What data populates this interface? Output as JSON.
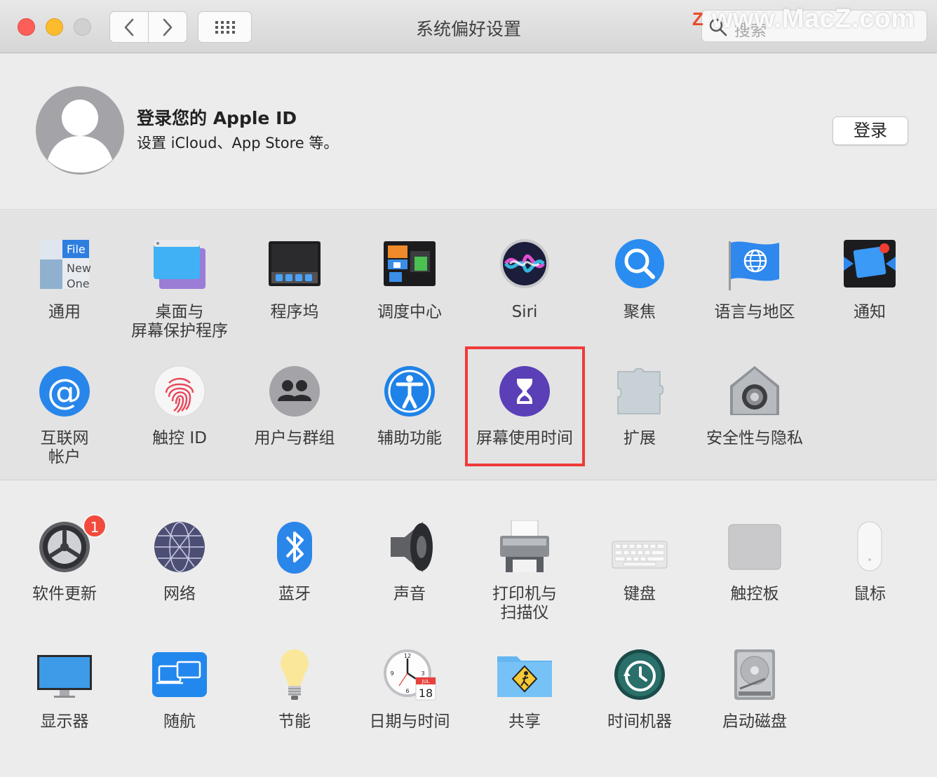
{
  "window": {
    "title": "系统偏好设置",
    "search_placeholder": "搜索"
  },
  "watermark": {
    "z": "Z",
    "text": "www.MacZ.com"
  },
  "account": {
    "title": "登录您的 Apple ID",
    "subtitle": "设置 iCloud、App Store 等。",
    "login_button": "登录"
  },
  "row1": [
    {
      "label": "通用",
      "icon": "general-icon"
    },
    {
      "label": "桌面与\n屏幕保护程序",
      "icon": "desktop-screensaver-icon"
    },
    {
      "label": "程序坞",
      "icon": "dock-icon"
    },
    {
      "label": "调度中心",
      "icon": "mission-control-icon"
    },
    {
      "label": "Siri",
      "icon": "siri-icon"
    },
    {
      "label": "聚焦",
      "icon": "spotlight-icon"
    },
    {
      "label": "语言与地区",
      "icon": "language-region-icon"
    },
    {
      "label": "通知",
      "icon": "notifications-icon"
    }
  ],
  "row2": [
    {
      "label": "互联网\n帐户",
      "icon": "internet-accounts-icon"
    },
    {
      "label": "触控 ID",
      "icon": "touch-id-icon"
    },
    {
      "label": "用户与群组",
      "icon": "users-groups-icon"
    },
    {
      "label": "辅助功能",
      "icon": "accessibility-icon"
    },
    {
      "label": "屏幕使用时间",
      "icon": "screen-time-icon"
    },
    {
      "label": "扩展",
      "icon": "extensions-icon"
    },
    {
      "label": "安全性与隐私",
      "icon": "security-privacy-icon"
    }
  ],
  "row3": [
    {
      "label": "软件更新",
      "icon": "software-update-icon",
      "badge": "1"
    },
    {
      "label": "网络",
      "icon": "network-icon"
    },
    {
      "label": "蓝牙",
      "icon": "bluetooth-icon"
    },
    {
      "label": "声音",
      "icon": "sound-icon"
    },
    {
      "label": "打印机与\n扫描仪",
      "icon": "printers-scanners-icon"
    },
    {
      "label": "键盘",
      "icon": "keyboard-icon"
    },
    {
      "label": "触控板",
      "icon": "trackpad-icon"
    },
    {
      "label": "鼠标",
      "icon": "mouse-icon"
    }
  ],
  "row4": [
    {
      "label": "显示器",
      "icon": "displays-icon"
    },
    {
      "label": "随航",
      "icon": "sidecar-icon"
    },
    {
      "label": "节能",
      "icon": "energy-saver-icon"
    },
    {
      "label": "日期与时间",
      "icon": "date-time-icon",
      "calendar_month": "JUL",
      "calendar_day": "18"
    },
    {
      "label": "共享",
      "icon": "sharing-icon"
    },
    {
      "label": "时间机器",
      "icon": "time-machine-icon"
    },
    {
      "label": "启动磁盘",
      "icon": "startup-disk-icon"
    }
  ],
  "general_icon_text": [
    "File",
    "New",
    "One"
  ],
  "highlight_color": "#ef3b3b",
  "badge_color": "#f24a3c"
}
